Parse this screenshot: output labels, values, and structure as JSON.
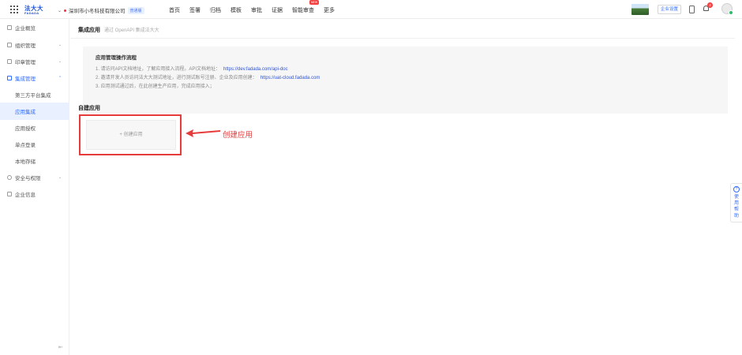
{
  "topbar": {
    "logo_cn": "法大大",
    "logo_en": "FADADA",
    "company_name": "深圳市小冬科技有限公司",
    "company_tag": "普通版",
    "nav": [
      "首页",
      "签署",
      "归档",
      "模板",
      "审批",
      "证据",
      "智能审查",
      "更多"
    ],
    "nav_badge": "NEW",
    "settings_label": "企业设置",
    "notification_count": "2"
  },
  "sidebar": {
    "items": [
      {
        "label": "企业概览",
        "icon": "overview-icon"
      },
      {
        "label": "组织管理",
        "icon": "org-icon"
      },
      {
        "label": "印章管理",
        "icon": "seal-icon"
      },
      {
        "label": "集成管理",
        "icon": "integration-icon"
      },
      {
        "label": "第三方平台集成"
      },
      {
        "label": "应用集成"
      },
      {
        "label": "应用授权"
      },
      {
        "label": "单点登录"
      },
      {
        "label": "本地存储"
      },
      {
        "label": "安全与权限",
        "icon": "security-icon"
      },
      {
        "label": "企业信息",
        "icon": "info-icon"
      }
    ],
    "collapse_icon": "collapse-icon"
  },
  "main": {
    "title": "集成应用",
    "subtitle": "通过 OpenAPI 集成法大大",
    "guide": {
      "heading": "应用管理操作流程",
      "line1": "1. 请访问API文档地址，了解应用接入流程。API文档地址：",
      "link1": "https://dev.fadada.com/api-doc",
      "line2": "2. 邀请开发人员访问法大大测试地址，进行测试账号注册、企业及应用创建：",
      "link2": "https://uat-cloud.fadada.com",
      "line3": "3. 应用测试通过后，在此创建生产应用，完成应用接入；"
    },
    "section_heading": "自建应用",
    "create_label": "+ 创建应用",
    "annotation": "创建应用"
  },
  "help": {
    "label": "使用帮助"
  },
  "colors": {
    "accent": "#2f6bff",
    "annotation_red": "#e63b3b",
    "link": "#2f55d4"
  }
}
